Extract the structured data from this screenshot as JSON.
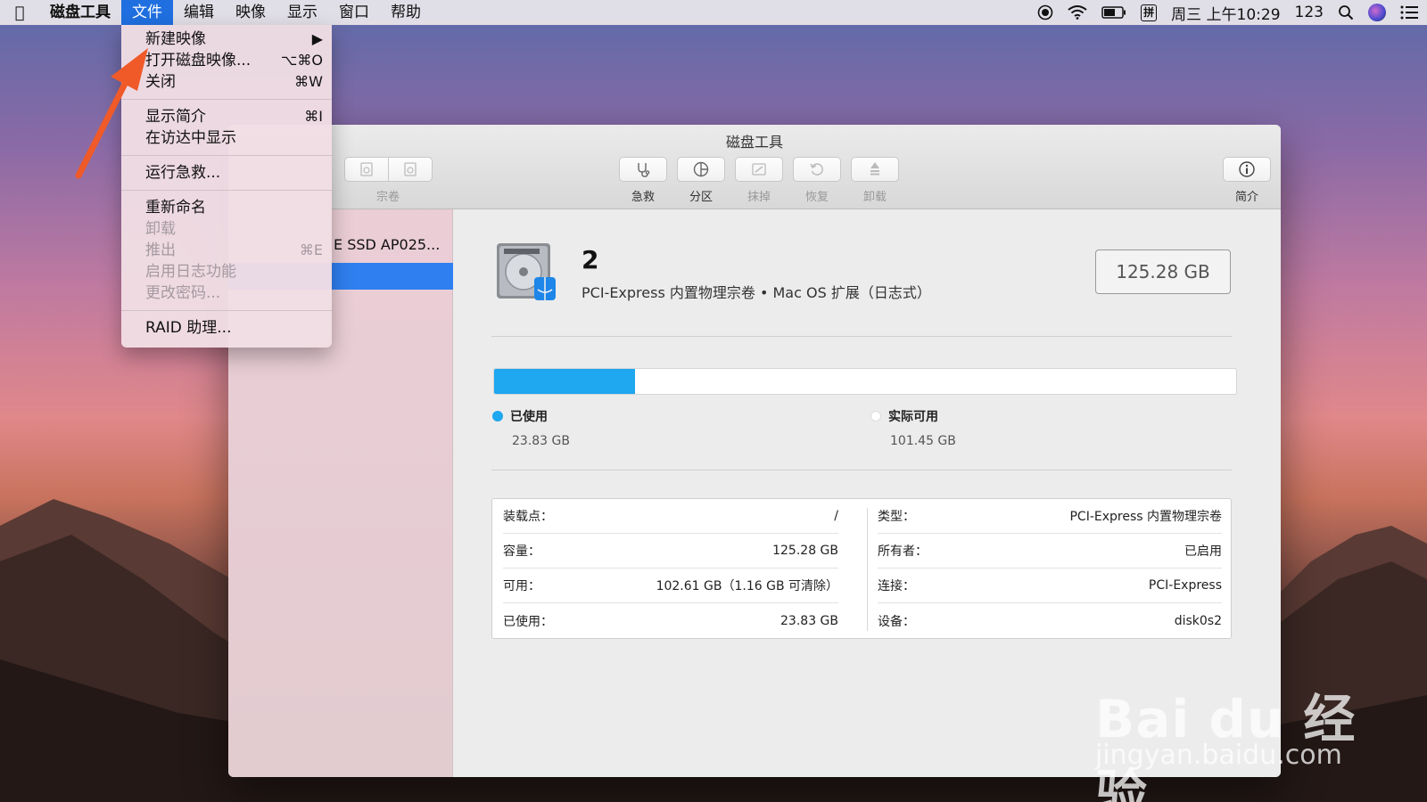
{
  "menubar": {
    "app": "磁盘工具",
    "items": [
      "文件",
      "编辑",
      "映像",
      "显示",
      "窗口",
      "帮助"
    ],
    "input_method": "拼",
    "datetime": "周三 上午10:29",
    "user": "123"
  },
  "file_menu": {
    "items": [
      {
        "label": "新建映像",
        "shortcut": "▶",
        "enabled": true
      },
      {
        "label": "打开磁盘映像...",
        "shortcut": "⌥⌘O",
        "enabled": true
      },
      {
        "label": "关闭",
        "shortcut": "⌘W",
        "enabled": true
      },
      {
        "label": "显示简介",
        "shortcut": "⌘I",
        "enabled": true
      },
      {
        "label": "在访达中显示",
        "shortcut": "",
        "enabled": true
      },
      {
        "label": "运行急救...",
        "shortcut": "",
        "enabled": true
      },
      {
        "label": "重新命名",
        "shortcut": "",
        "enabled": true
      },
      {
        "label": "卸载",
        "shortcut": "",
        "enabled": false
      },
      {
        "label": "推出",
        "shortcut": "⌘E",
        "enabled": false
      },
      {
        "label": "启用日志功能",
        "shortcut": "",
        "enabled": false
      },
      {
        "label": "更改密码...",
        "shortcut": "",
        "enabled": false
      },
      {
        "label": "RAID 助理...",
        "shortcut": "",
        "enabled": true
      }
    ]
  },
  "window": {
    "title": "磁盘工具",
    "toolbar": {
      "volume": "宗卷",
      "first_aid": "急救",
      "partition": "分区",
      "erase": "抹掉",
      "restore": "恢复",
      "unmount": "卸载",
      "info": "简介"
    },
    "sidebar": {
      "disk_label": "E SSD AP025..."
    },
    "volume": {
      "name": "2",
      "description": "PCI-Express 内置物理宗卷 • Mac OS 扩展（日志式）",
      "capacity": "125.28 GB",
      "used_fraction": 0.19,
      "used_label": "已使用",
      "used_value": "23.83 GB",
      "free_label": "实际可用",
      "free_value": "101.45 GB",
      "colors": {
        "used": "#1fa7f0",
        "free": "#ffffff"
      }
    },
    "info_left": [
      {
        "k": "装载点：",
        "v": "/"
      },
      {
        "k": "容量：",
        "v": "125.28 GB"
      },
      {
        "k": "可用：",
        "v": "102.61 GB（1.16 GB 可清除）"
      },
      {
        "k": "已使用：",
        "v": "23.83 GB"
      }
    ],
    "info_right": [
      {
        "k": "类型：",
        "v": "PCI-Express 内置物理宗卷"
      },
      {
        "k": "所有者：",
        "v": "已启用"
      },
      {
        "k": "连接：",
        "v": "PCI-Express"
      },
      {
        "k": "设备：",
        "v": "disk0s2"
      }
    ]
  },
  "watermark": {
    "main": "Bai du 经验",
    "sub": "jingyan.baidu.com"
  }
}
